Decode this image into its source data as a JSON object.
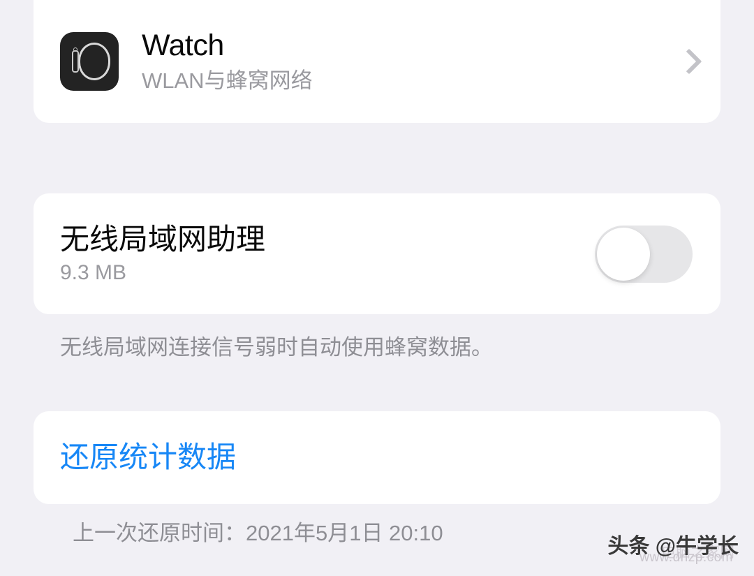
{
  "theme": {
    "background": "#F1F0F5",
    "card_background": "#FFFFFF",
    "primary_text": "#0A0A0A",
    "secondary_text": "#9A9A9F",
    "footnote_text": "#8E8E94",
    "accent_blue": "#1787F6",
    "chevron_gray": "#C3C3C8",
    "toggle_off_track": "#E6E6E8",
    "app_icon_background": "#232323"
  },
  "watch_row": {
    "icon": "apple-watch-icon",
    "title": "Watch",
    "subtitle": "WLAN与蜂窝网络",
    "chevron": "chevron-right-icon"
  },
  "wlan_assist": {
    "title": "无线局域网助理",
    "data_usage": "9.3 MB",
    "toggle_state": "off",
    "footnote": "无线局域网连接信号弱时自动使用蜂窝数据。"
  },
  "reset": {
    "label": "还原统计数据",
    "last_reset_text": "上一次还原时间：2021年5月1日 20:10"
  },
  "watermarks": {
    "primary": "头条 @牛学长",
    "secondary_cn": "电脑之家网",
    "secondary_url": "www.dnzp.com"
  }
}
